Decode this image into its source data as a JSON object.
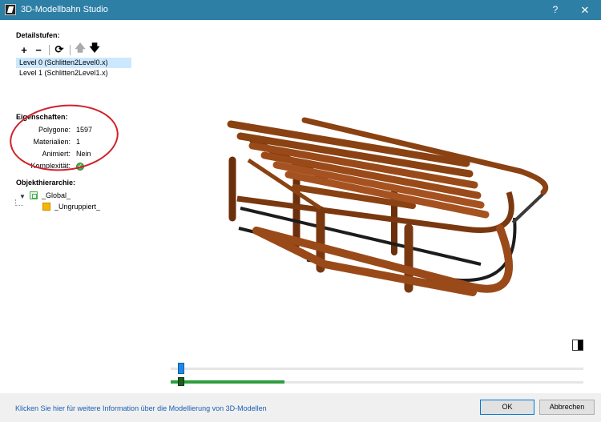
{
  "window": {
    "title": "3D-Modellbahn Studio",
    "help": "?",
    "close": "✕"
  },
  "lod": {
    "title": "Detailstufen:",
    "toolbar": {
      "add": "+",
      "remove": "−",
      "refresh": "⟳",
      "up": "🡅",
      "down": "🡇"
    },
    "items": [
      {
        "label": "Level 0 (Schlitten2Level0.x)",
        "selected": true
      },
      {
        "label": "Level 1 (Schlitten2Level1.x)",
        "selected": false
      }
    ]
  },
  "properties": {
    "title": "Eigenschaften:",
    "rows": [
      {
        "label": "Polygone:",
        "value": "1597"
      },
      {
        "label": "Materialien:",
        "value": "1"
      },
      {
        "label": "Animiert:",
        "value": "Nein"
      },
      {
        "label": "Komplexität:",
        "value": "ok-check-icon"
      }
    ]
  },
  "hierarchy": {
    "title": "Objekthierarchie:",
    "nodes": [
      {
        "label": "_Global_",
        "expanded": true
      },
      {
        "label": "_Ungruppiert_"
      }
    ]
  },
  "preview": {
    "slider1_level": 0.03,
    "slider2_level": 0.28
  },
  "footer": {
    "info_link": "Klicken Sie hier für weitere Information über die Modellierung von 3D-Modellen",
    "ok": "OK",
    "cancel": "Abbrechen"
  },
  "colors": {
    "titlebar": "#2d7fa6",
    "selection": "#cce8ff",
    "wood": "#9a4a19",
    "annotation": "#d0202a"
  }
}
